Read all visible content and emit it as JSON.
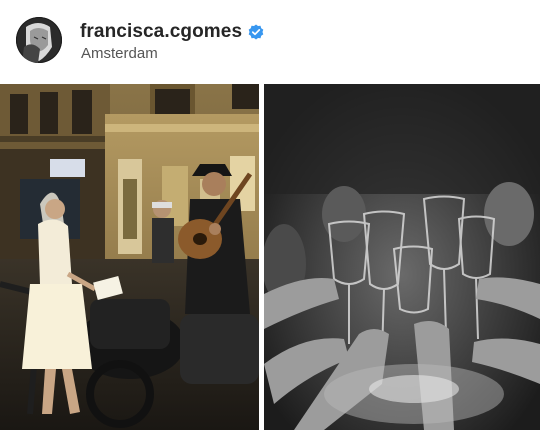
{
  "post": {
    "username": "francisca.cgomes",
    "location": "Amsterdam",
    "verified": true
  },
  "icons": {
    "verified": "verified-badge-icon"
  },
  "colors": {
    "verified_blue": "#3897f0",
    "username": "#262626",
    "location": "#555555"
  }
}
